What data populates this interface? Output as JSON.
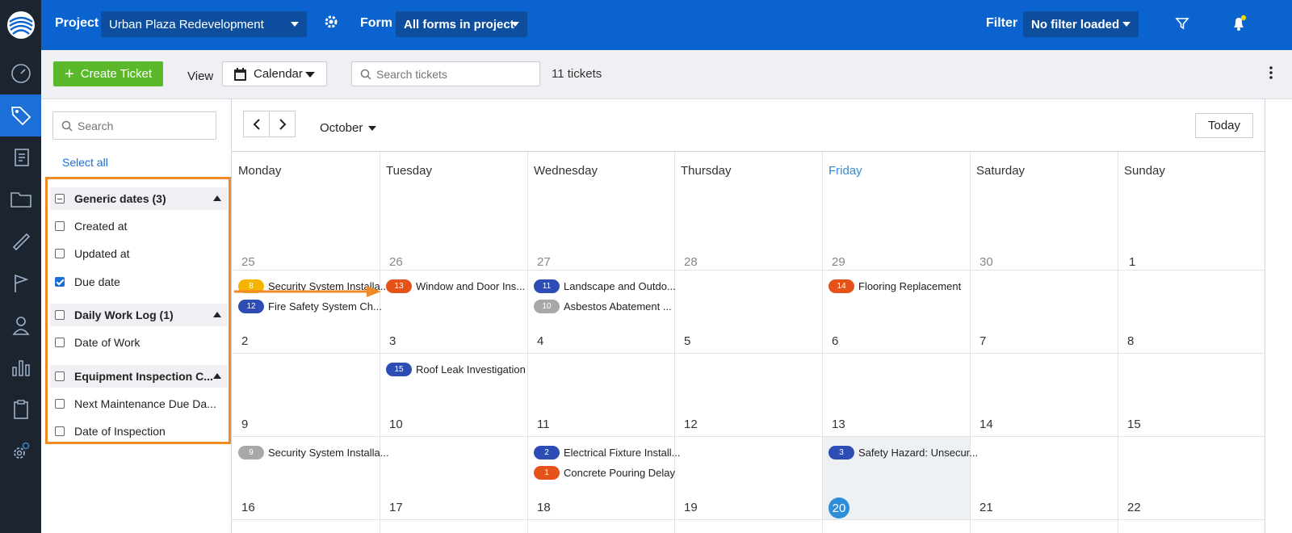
{
  "topbar": {
    "project_label": "Project",
    "project_value": "Urban Plaza Redevelopment",
    "form_label": "Form",
    "form_value": "All forms in project",
    "filter_label": "Filter",
    "filter_value": "No filter loaded"
  },
  "toolbar": {
    "create_label": "Create Ticket",
    "view_label": "View",
    "view_value": "Calendar",
    "search_placeholder": "Search tickets",
    "ticket_count": "11 tickets"
  },
  "filters": {
    "search_placeholder": "Search",
    "select_all": "Select all",
    "rows": [
      {
        "label": "Generic dates (3)",
        "group": true,
        "state": "partial"
      },
      {
        "label": "Created at",
        "group": false,
        "state": "unchecked"
      },
      {
        "label": "Updated at",
        "group": false,
        "state": "unchecked"
      },
      {
        "label": "Due date",
        "group": false,
        "state": "checked"
      },
      {
        "label": "Daily Work Log (1)",
        "group": true,
        "state": "unchecked"
      },
      {
        "label": "Date of Work",
        "group": false,
        "state": "unchecked"
      },
      {
        "label": "Equipment Inspection C...",
        "group": true,
        "state": "unchecked"
      },
      {
        "label": "Next Maintenance Due Da...",
        "group": false,
        "state": "unchecked"
      },
      {
        "label": "Date of Inspection",
        "group": false,
        "state": "unchecked"
      }
    ]
  },
  "calendar": {
    "month": "October",
    "today_label": "Today",
    "days": [
      "Monday",
      "Tuesday",
      "Wednesday",
      "Thursday",
      "Friday",
      "Saturday",
      "Sunday"
    ],
    "weeks": [
      [
        "25",
        "26",
        "27",
        "28",
        "29",
        "30",
        "1"
      ],
      [
        "2",
        "3",
        "4",
        "5",
        "6",
        "7",
        "8"
      ],
      [
        "9",
        "10",
        "11",
        "12",
        "13",
        "14",
        "15"
      ],
      [
        "16",
        "17",
        "18",
        "19",
        "20",
        "21",
        "22"
      ]
    ],
    "events": [
      {
        "week": 1,
        "day": 0,
        "slot": 0,
        "num": "8",
        "color": "#f5b400",
        "title": "Security System Installa..."
      },
      {
        "week": 1,
        "day": 0,
        "slot": 1,
        "num": "12",
        "color": "#2d4db5",
        "title": "Fire Safety System Ch..."
      },
      {
        "week": 1,
        "day": 1,
        "slot": 0,
        "num": "13",
        "color": "#e5531a",
        "title": "Window and Door Ins..."
      },
      {
        "week": 1,
        "day": 2,
        "slot": 0,
        "num": "11",
        "color": "#2d4db5",
        "title": "Landscape and Outdo..."
      },
      {
        "week": 1,
        "day": 2,
        "slot": 1,
        "num": "10",
        "color": "#a8a8a8",
        "title": "Asbestos Abatement ..."
      },
      {
        "week": 1,
        "day": 4,
        "slot": 0,
        "num": "14",
        "color": "#e5531a",
        "title": "Flooring Replacement"
      },
      {
        "week": 2,
        "day": 1,
        "slot": 0,
        "num": "15",
        "color": "#2d4db5",
        "title": "Roof Leak Investigation"
      },
      {
        "week": 3,
        "day": 0,
        "slot": 0,
        "num": "9",
        "color": "#a8a8a8",
        "title": "Security System Installa..."
      },
      {
        "week": 3,
        "day": 2,
        "slot": 0,
        "num": "2",
        "color": "#2d4db5",
        "title": "Electrical Fixture Install..."
      },
      {
        "week": 3,
        "day": 2,
        "slot": 1,
        "num": "1",
        "color": "#e5531a",
        "title": "Concrete Pouring Delay"
      },
      {
        "week": 3,
        "day": 4,
        "slot": 0,
        "num": "3",
        "color": "#2d4db5",
        "title": "Safety Hazard: Unsecur..."
      }
    ]
  },
  "colors": {
    "brand": "#0a63cf",
    "accent_green": "#5cb82b",
    "highlight": "#f08a24"
  }
}
